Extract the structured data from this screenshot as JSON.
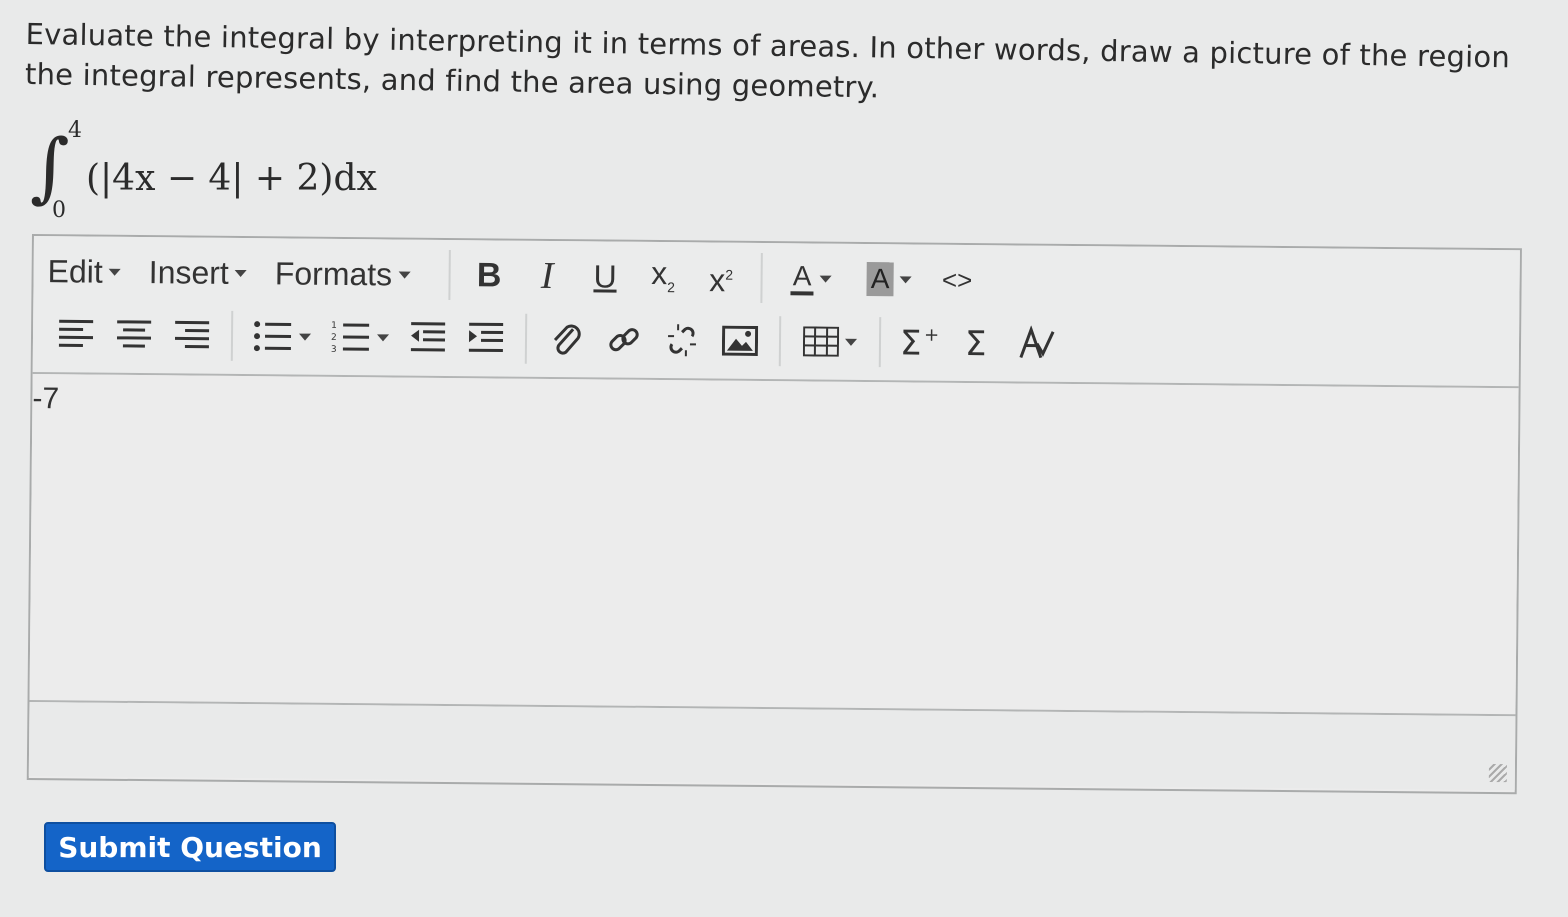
{
  "question": {
    "text": "Evaluate the integral by interpreting it in terms of areas. In other words, draw a picture of the region the integral represents, and find the area using geometry."
  },
  "math": {
    "upper_limit": "4",
    "lower_limit": "0",
    "integrand": "(|4x − 4| + 2)dx"
  },
  "toolbar": {
    "menus": {
      "edit": "Edit",
      "insert": "Insert",
      "formats": "Formats"
    },
    "bold": "B",
    "italic": "I",
    "underline": "U",
    "subscript": "x",
    "subscript_mark": "2",
    "superscript": "x",
    "superscript_mark": "2",
    "font_color": "A",
    "bg_color": "A",
    "code": "<>"
  },
  "editor": {
    "content": "-7"
  },
  "submit": {
    "label": "Submit Question"
  }
}
